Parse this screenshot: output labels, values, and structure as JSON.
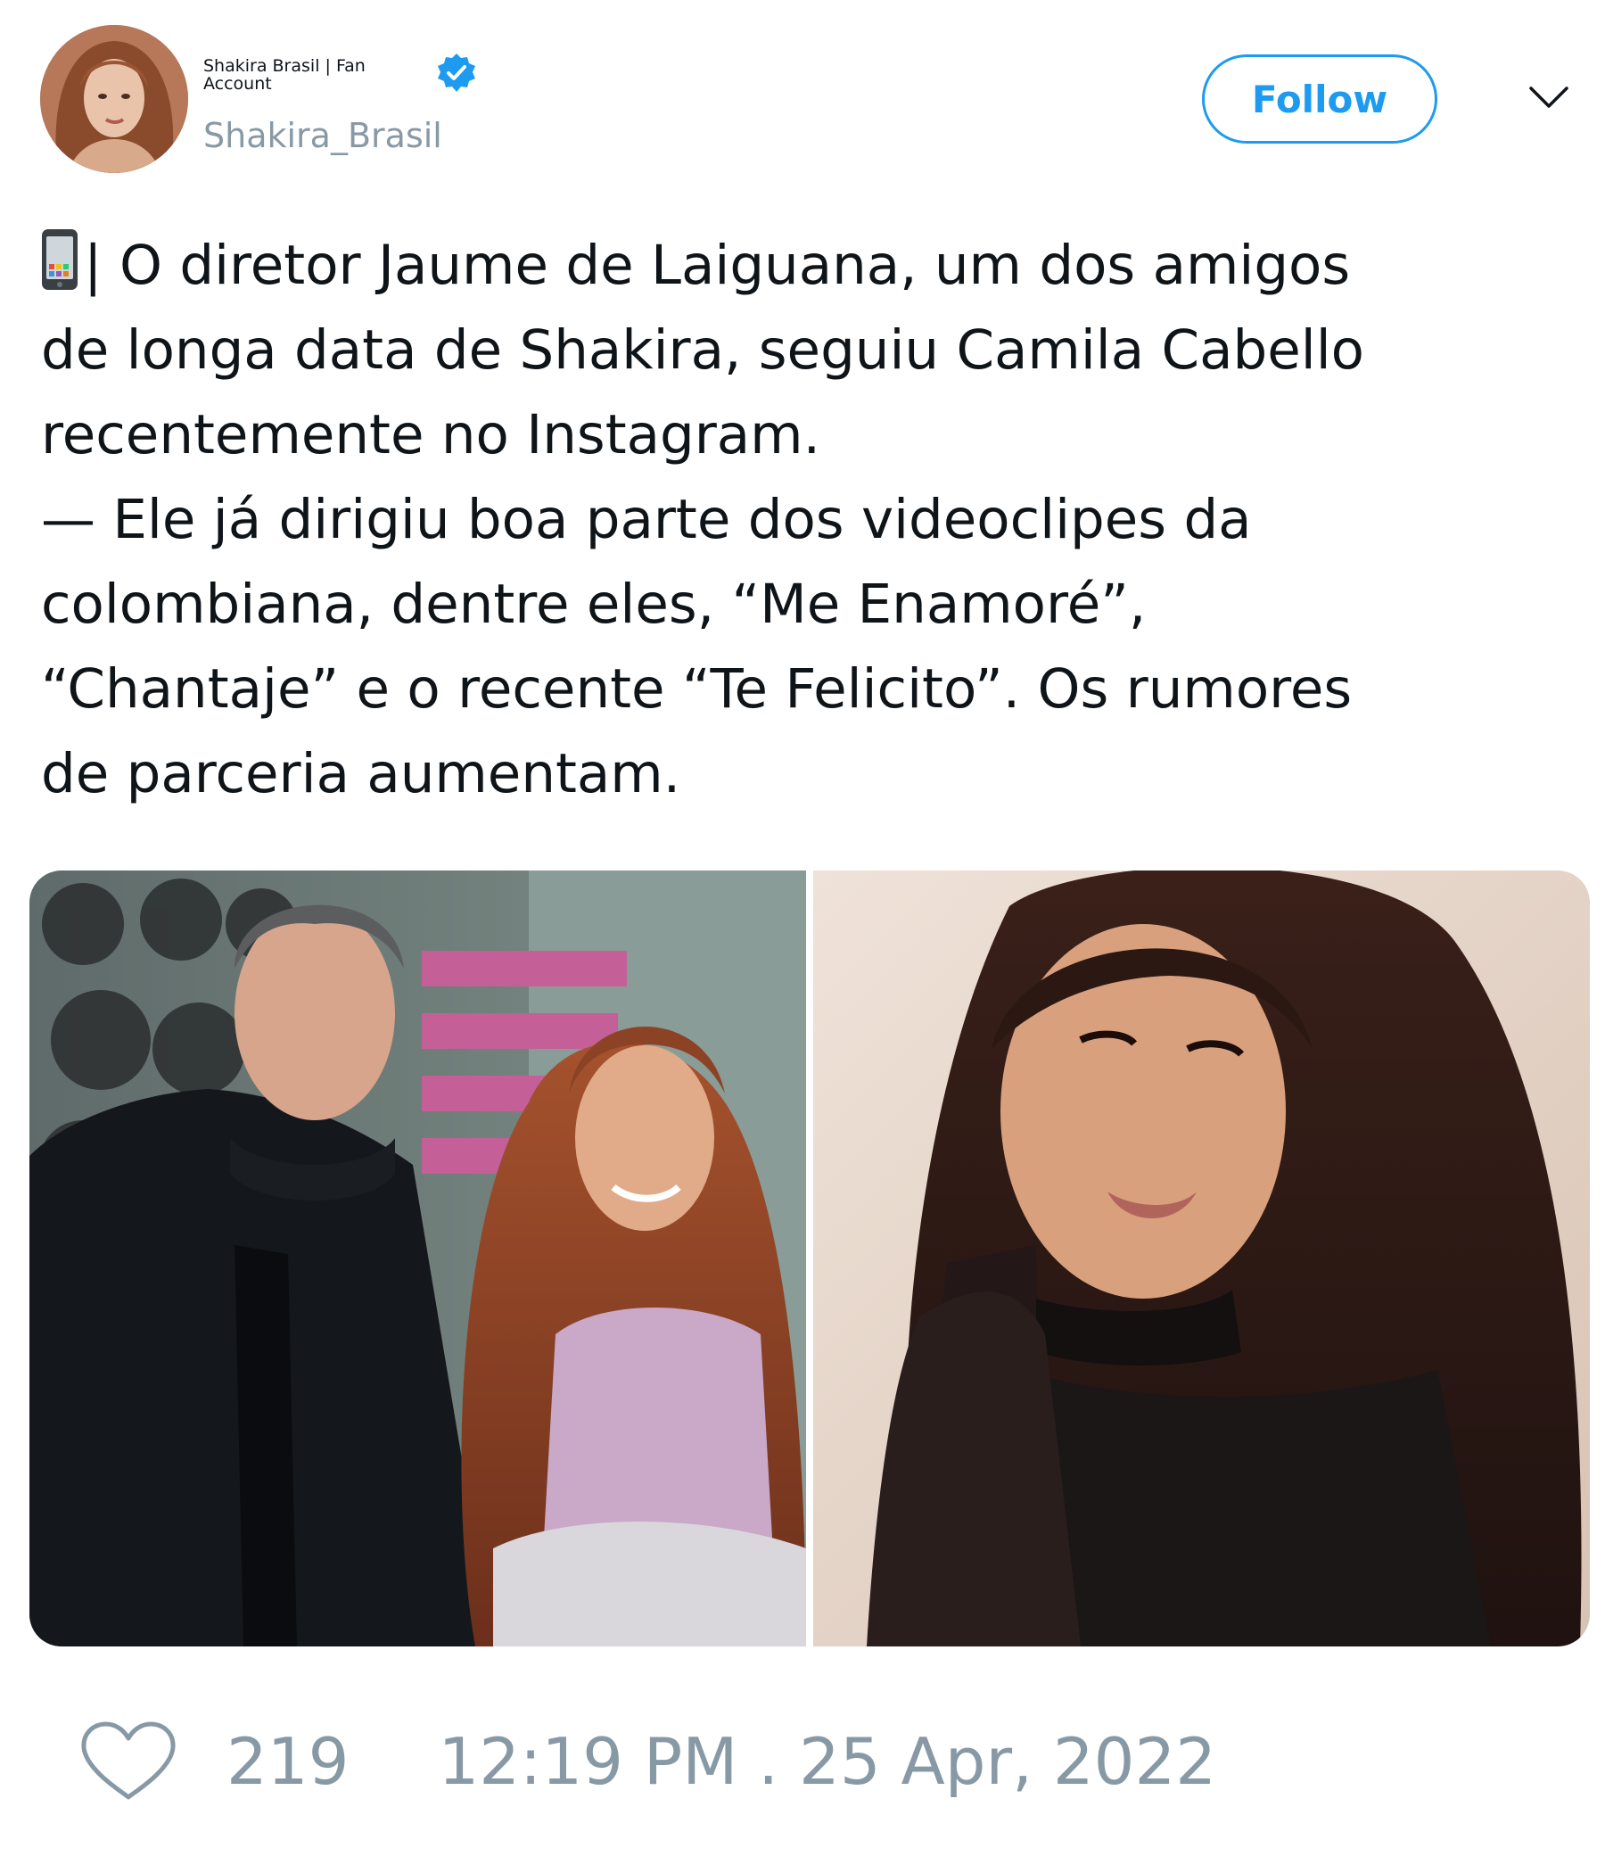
{
  "author": {
    "display_name": "Shakira Brasil | Fan Account",
    "username": "Shakira_Brasil",
    "verified": true
  },
  "follow_button": {
    "label": "Follow"
  },
  "tweet": {
    "lines": [
      "| O diretor Jaume de Laiguana, um dos amigos",
      "de longa data de Shakira, seguiu Camila Cabello",
      "recentemente no Instagram.",
      "— Ele já dirigiu boa parte dos videoclipes da",
      "colombiana, dentre eles, “Me Enamoré”,",
      "“Chantaje” e o recente “Te Felicito”. Os rumores",
      "de parceria aumentam."
    ],
    "leading_emoji": "mobile-phone-emoji"
  },
  "media": [
    {
      "icon": "photo-of-man-and-woman"
    },
    {
      "icon": "photo-of-woman-portrait"
    }
  ],
  "footer": {
    "like_count": "219",
    "timestamp": "12:19 PM . 25 Apr, 2022"
  },
  "colors": {
    "accent": "#1d9bf0",
    "muted": "#8899a6",
    "text": "#0f1419"
  }
}
